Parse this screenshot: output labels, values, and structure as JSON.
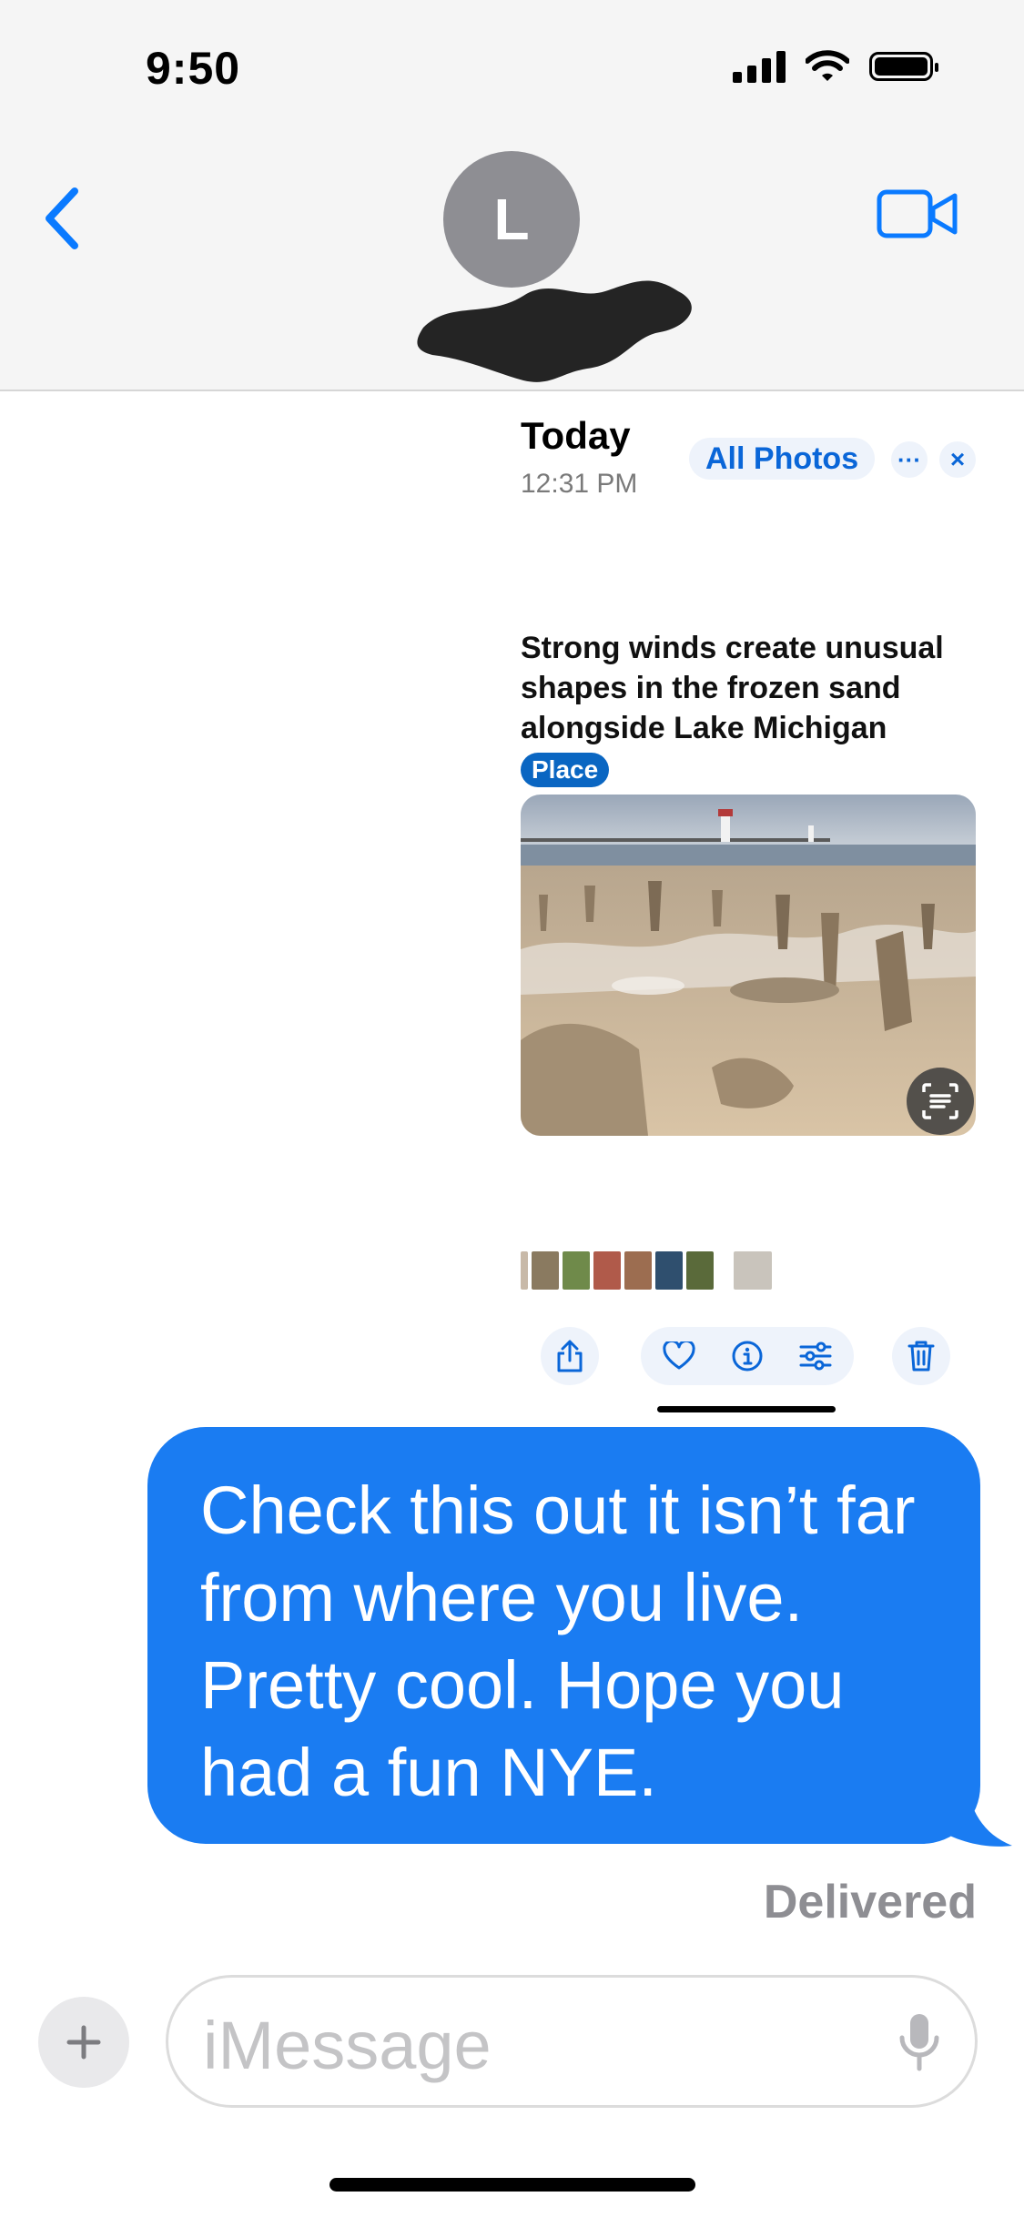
{
  "status_bar": {
    "time": "9:50"
  },
  "header": {
    "avatar_initial": "L",
    "back_icon": "chevron-left-icon",
    "video_icon": "video-camera-icon"
  },
  "photo_card": {
    "date_label": "Today",
    "time_label": "12:31 PM",
    "all_photos_label": "All Photos",
    "more_label": "···",
    "close_label": "×",
    "headline": "Strong winds create unusual shapes in the frozen sand alongside Lake Michigan",
    "badge": "Place",
    "toolbar_icons": [
      "share-icon",
      "heart-icon",
      "info-icon",
      "adjust-icon",
      "trash-icon"
    ]
  },
  "message": {
    "text": "Check this out it isn’t far from where you live. Pretty cool. Hope you had a fun NYE.",
    "status": "Delivered"
  },
  "composer": {
    "placeholder": "iMessage"
  },
  "colors": {
    "accent": "#0a66d8",
    "bubble": "#1a7cf2",
    "badge": "#0a66c2"
  }
}
